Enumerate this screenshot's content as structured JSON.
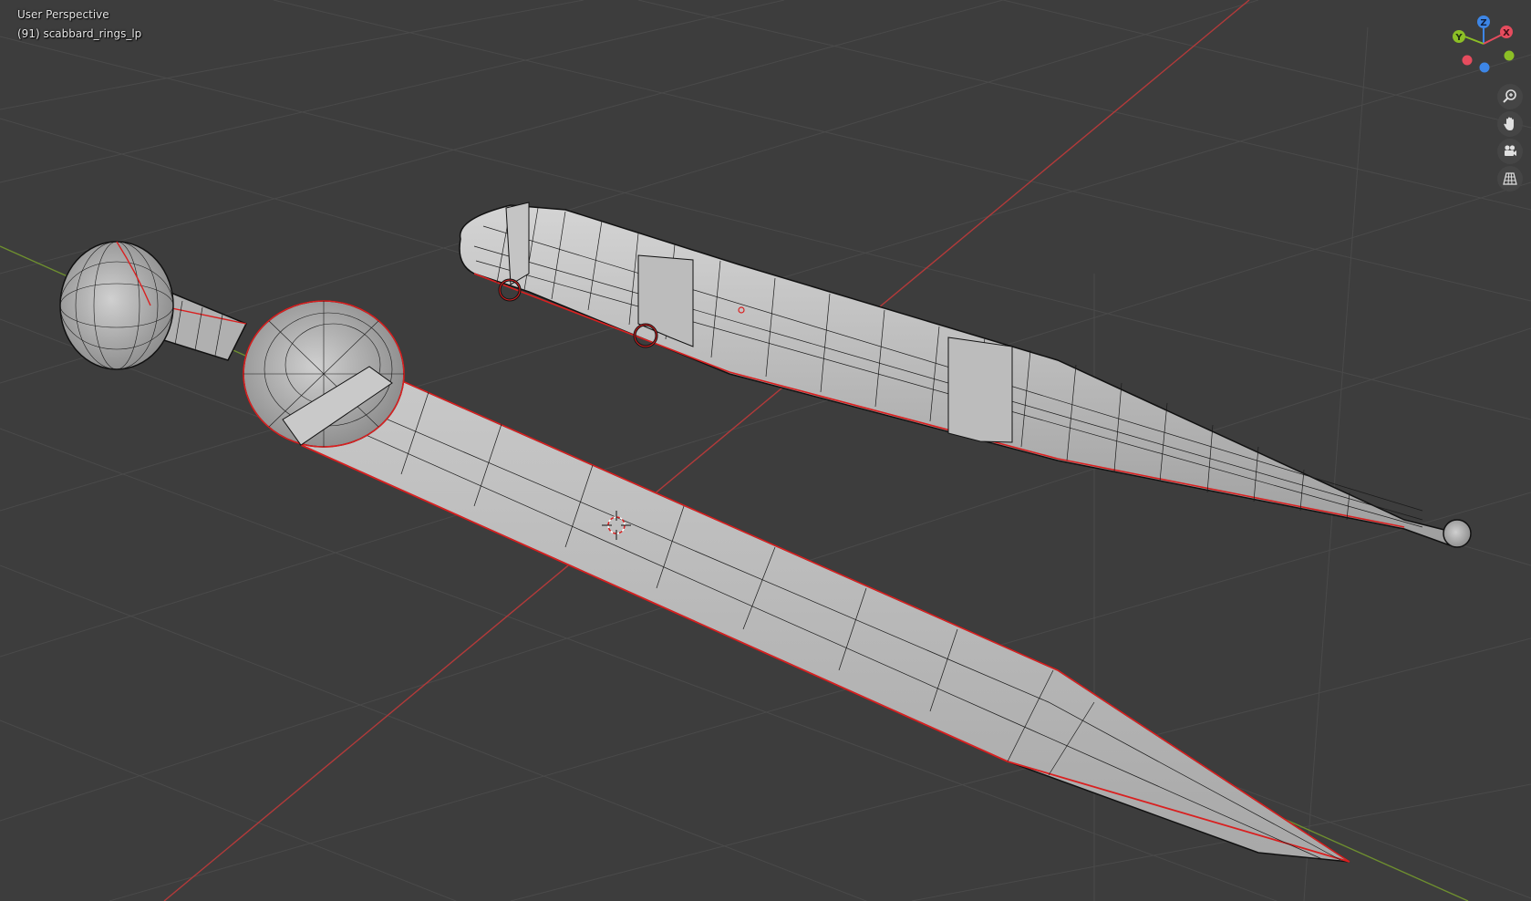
{
  "viewport": {
    "view_name": "User Perspective",
    "active_object": "(91) scabbard_rings_lp"
  },
  "gizmo": {
    "axes": [
      {
        "label": "Z",
        "color": "#3d86e6"
      },
      {
        "label": "Y",
        "color": "#8cbf26"
      },
      {
        "label": "X",
        "color": "#e64c5e"
      }
    ]
  },
  "navigation": [
    {
      "name": "zoom",
      "icon": "zoom-icon"
    },
    {
      "name": "pan",
      "icon": "hand-icon"
    },
    {
      "name": "camera",
      "icon": "camera-icon"
    },
    {
      "name": "perspective",
      "icon": "grid-icon"
    }
  ],
  "colors": {
    "background": "#3d3d3d",
    "grid": "#4a4a4a",
    "x_axis": "#b23a3a",
    "y_axis": "#6e8f2f",
    "mesh_fill": "#b8b8b8",
    "wire": "#1a1a1a",
    "seam": "#d92020"
  }
}
